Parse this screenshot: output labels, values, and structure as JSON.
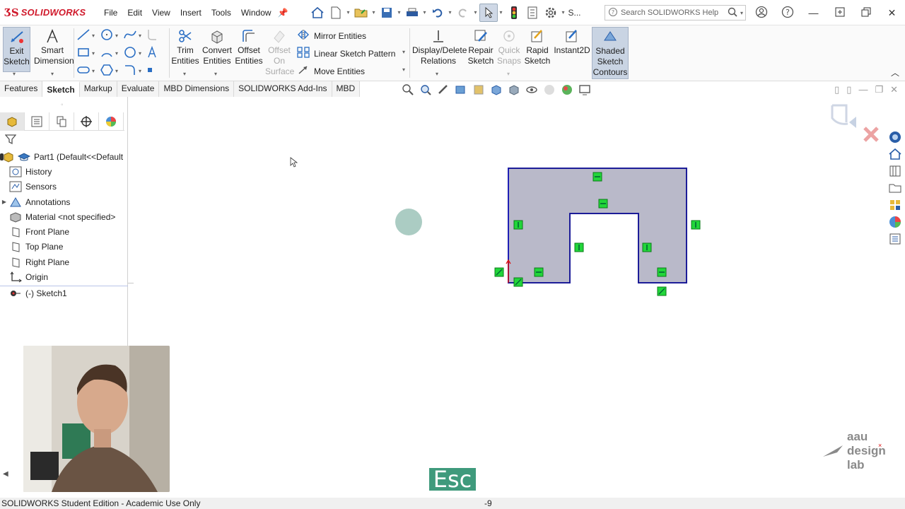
{
  "app": {
    "logo": "SOLIDWORKS"
  },
  "menu": [
    "File",
    "Edit",
    "View",
    "Insert",
    "Tools",
    "Window"
  ],
  "search": {
    "placeholder": "Search SOLIDWORKS Help",
    "prefix": "S..."
  },
  "ribbon": {
    "exit_sketch": [
      "Exit",
      "Sketch"
    ],
    "smart_dimension": [
      "Smart",
      "Dimension"
    ],
    "trim_entities": [
      "Trim",
      "Entities"
    ],
    "convert_entities": [
      "Convert",
      "Entities"
    ],
    "offset_entities": [
      "Offset",
      "Entities"
    ],
    "offset_on_surface": [
      "Offset",
      "On",
      "Surface"
    ],
    "mirror_entities": "Mirror Entities",
    "linear_sketch_pattern": "Linear Sketch Pattern",
    "move_entities": "Move Entities",
    "display_delete_relations": [
      "Display/Delete",
      "Relations"
    ],
    "repair_sketch": [
      "Repair",
      "Sketch"
    ],
    "quick_snaps": [
      "Quick",
      "Snaps"
    ],
    "rapid_sketch": [
      "Rapid",
      "Sketch"
    ],
    "instant2d": "Instant2D",
    "shaded_sketch_contours": [
      "Shaded",
      "Sketch",
      "Contours"
    ]
  },
  "tabs": [
    "Features",
    "Sketch",
    "Markup",
    "Evaluate",
    "MBD Dimensions",
    "SOLIDWORKS Add-Ins",
    "MBD"
  ],
  "active_tab": "Sketch",
  "tree": {
    "root": "Part1  (Default<<Default",
    "items": [
      "History",
      "Sensors",
      "Annotations",
      "Material <not specified>",
      "Front Plane",
      "Top Plane",
      "Right Plane",
      "Origin",
      "(-) Sketch1"
    ]
  },
  "status": {
    "text": "SOLIDWORKS Student Edition - Academic Use Only",
    "coord": "-9"
  },
  "overlay": {
    "key": "Esc",
    "brand": [
      "aau",
      "design",
      "lab"
    ]
  },
  "colors": {
    "sketch_fill": "#b9b9c9",
    "sketch_line": "#1f1fb4",
    "relation": "#22d63a",
    "accent": "#d0192b"
  }
}
